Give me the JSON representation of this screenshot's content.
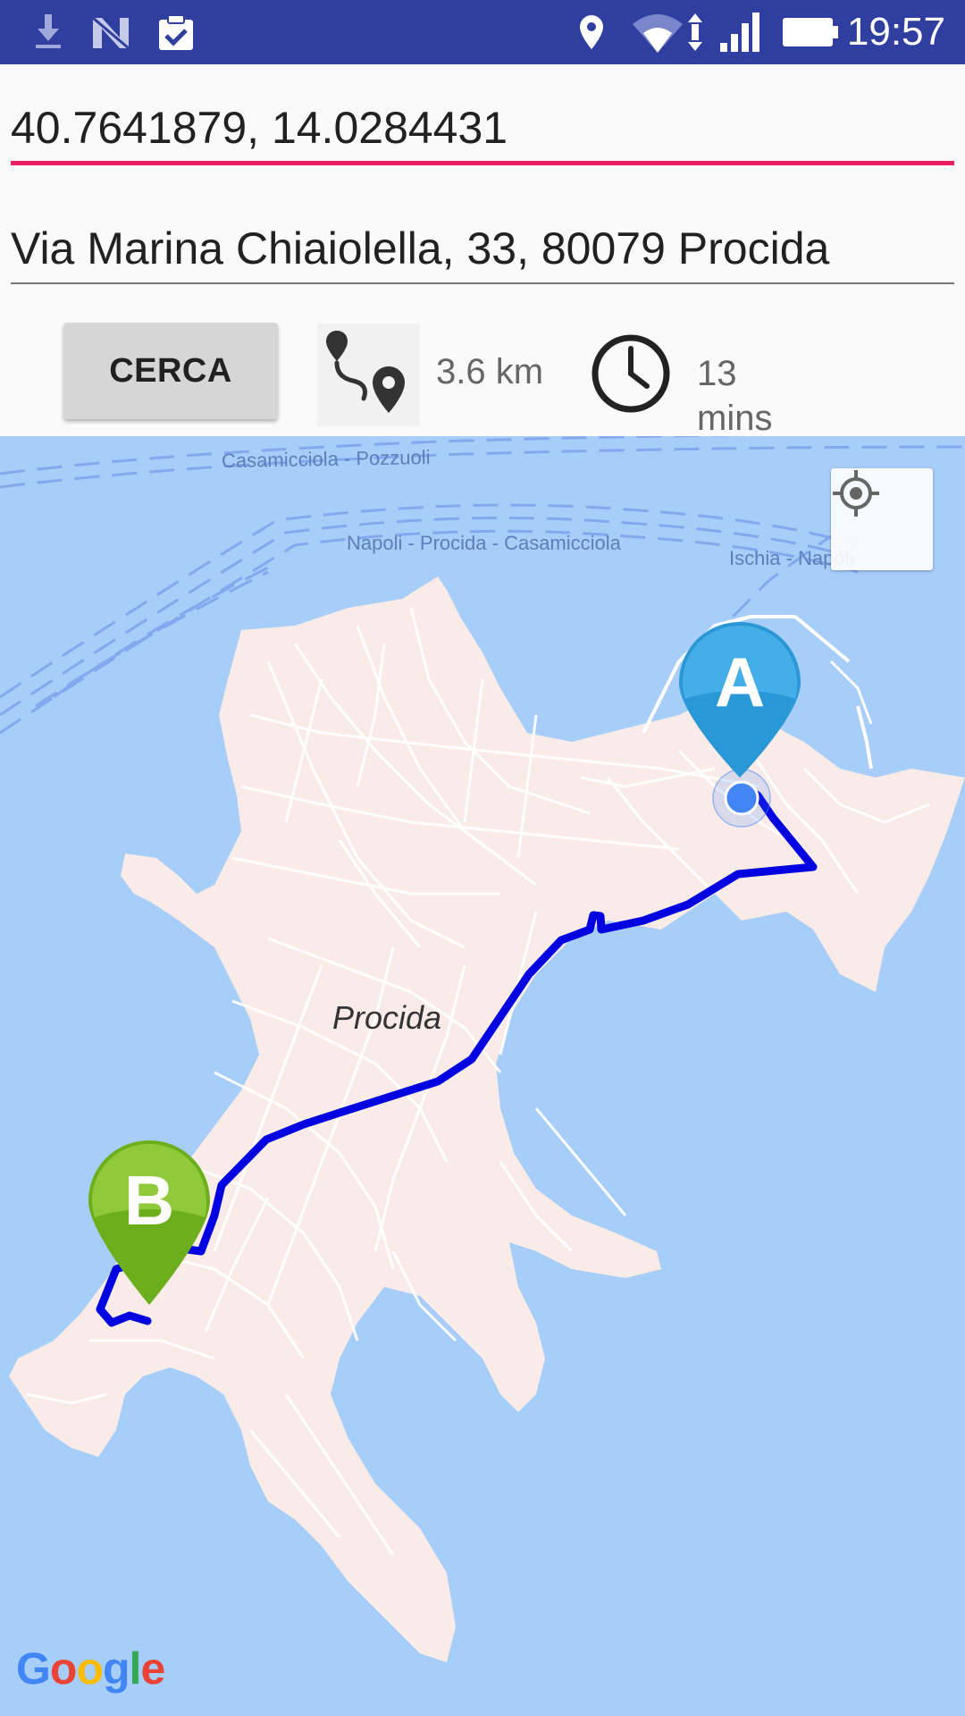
{
  "status_bar": {
    "time": "19:57",
    "icons": [
      "download-icon",
      "n-app-icon",
      "clipboard-check-icon",
      "location-icon",
      "wifi-icon",
      "signal-icon",
      "battery-icon"
    ]
  },
  "origin_field": {
    "value": "40.7641879, 14.0284431"
  },
  "destination_field": {
    "value": "Via Marina Chiaiolella, 33, 80079 Procida"
  },
  "search_button": {
    "label": "CERCA"
  },
  "route_info": {
    "distance": "3.6 km",
    "duration": "13 mins"
  },
  "map": {
    "labels": {
      "ferry_1": "Casamicciola - Pozzuoli",
      "ferry_2": "Napoli - Procida - Casamicciola",
      "ferry_3": "Ischia - Napoli",
      "island": "Procida"
    },
    "marker_a": "A",
    "marker_b": "B",
    "route_color": "#0000e0",
    "marker_a_color": "#2a97d6",
    "marker_b_color": "#6cae1c",
    "attribution": "Google"
  },
  "colors": {
    "status_bar": "#303f9f",
    "accent": "#e91e63",
    "water": "#a7cdf9",
    "land": "#f9ece8"
  }
}
